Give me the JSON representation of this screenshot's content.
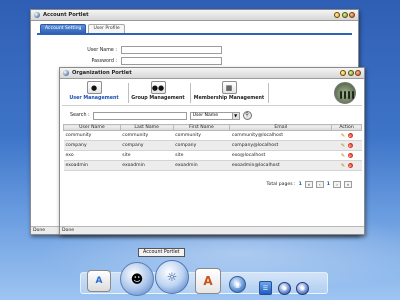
{
  "account_portlet": {
    "title": "Account Portlet",
    "tabs": [
      "Account Setting",
      "User Profile"
    ],
    "fields": [
      {
        "label": "User Name :",
        "value": ""
      },
      {
        "label": "Password :",
        "value": ""
      }
    ],
    "status": "Done"
  },
  "org_portlet": {
    "title": "Organization Portlet",
    "toolbar": [
      {
        "label": "User Management",
        "icon": "user-icon",
        "active": true
      },
      {
        "label": "Group Management",
        "icon": "group-icon",
        "active": false
      },
      {
        "label": "Membership Management",
        "icon": "membership-icon",
        "active": false
      }
    ],
    "search": {
      "label": "Search :",
      "value": "",
      "field_option": "User Name"
    },
    "table": {
      "headers": [
        "User Name",
        "Last Name",
        "First Name",
        "Email",
        "Action"
      ],
      "rows": [
        [
          "community",
          "community",
          "community",
          "community@localhost"
        ],
        [
          "company",
          "company",
          "company",
          "company@localhost"
        ],
        [
          "exo",
          "site",
          "site",
          "exo@localhost"
        ],
        [
          "exoadmin",
          "exoadmin",
          "exoadmin",
          "exoadmin@localhost"
        ]
      ]
    },
    "pager": {
      "label": "Total pages :",
      "total": "1",
      "current": "1"
    },
    "status": "Done"
  },
  "tooltip": "Account Portlet",
  "colors": {
    "accent": "#2f62b8",
    "desktop": "#3e74c8"
  }
}
